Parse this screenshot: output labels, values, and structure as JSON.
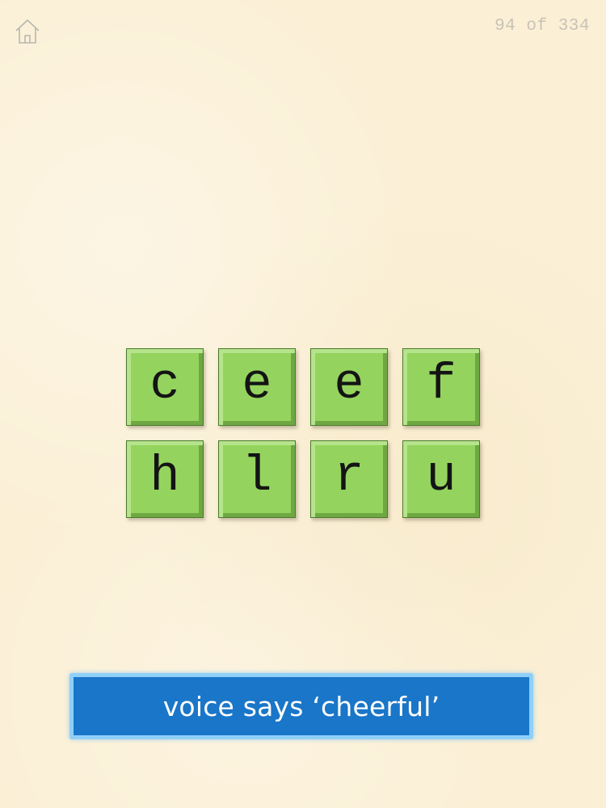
{
  "header": {
    "home_icon": "home-icon",
    "progress_text": "94 of 334"
  },
  "tiles": [
    {
      "letter": "c"
    },
    {
      "letter": "e"
    },
    {
      "letter": "e"
    },
    {
      "letter": "f"
    },
    {
      "letter": "h"
    },
    {
      "letter": "l"
    },
    {
      "letter": "r"
    },
    {
      "letter": "u"
    }
  ],
  "prompt": {
    "text": "voice says ‘cheerful’"
  },
  "colors": {
    "background": "#fbf0d6",
    "tile_green": "#94d45e",
    "banner_blue": "#1a76c8",
    "banner_border": "#8fd0f8",
    "progress_gray": "#c9c3b6"
  }
}
